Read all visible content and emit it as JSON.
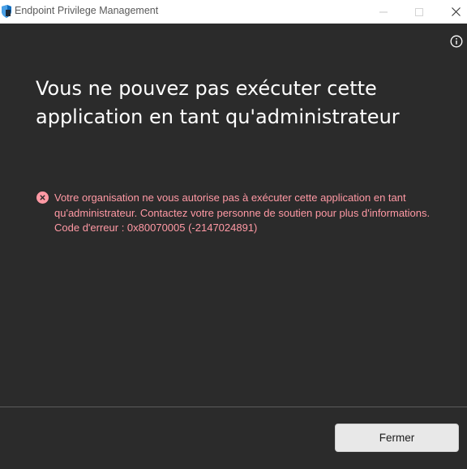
{
  "window": {
    "title": "Endpoint Privilege Management",
    "icons": {
      "app": "shield-app-icon",
      "minimize": "minimize-icon",
      "maximize": "maximize-icon",
      "close": "close-icon",
      "info": "info-icon",
      "error": "error-icon"
    }
  },
  "content": {
    "heading": "Vous ne pouvez pas exécuter cette application en tant qu'administrateur",
    "error_message": "Votre organisation ne vous autorise pas à exécuter cette application en tant qu'administrateur. Contactez votre personne de soutien pour plus d'informations. Code d'erreur : 0x80070005 (-2147024891)"
  },
  "footer": {
    "close_button_label": "Fermer"
  },
  "colors": {
    "background": "#2b2b2b",
    "titlebar": "#ffffff",
    "heading_text": "#ffffff",
    "error_text": "#ff99a4",
    "error_icon": "#ff99a4",
    "button_bg": "#e8e8e8",
    "divider": "#5c5c5c"
  }
}
